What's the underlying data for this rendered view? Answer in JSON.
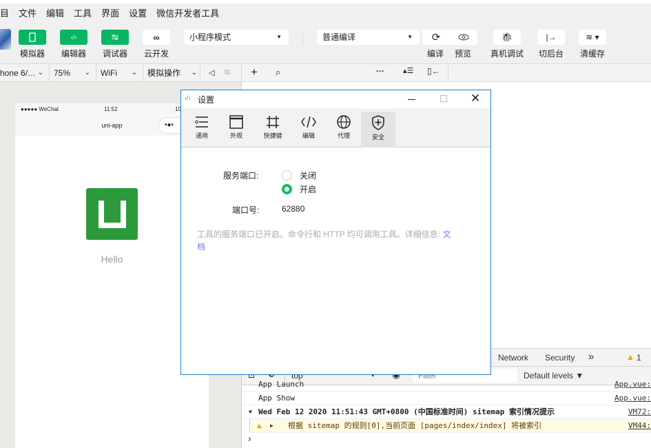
{
  "menu": [
    "目",
    "文件",
    "编辑",
    "工具",
    "界面",
    "设置",
    "微信开发者工具"
  ],
  "toolbar": {
    "simulator": "模拟器",
    "editor": "编辑器",
    "debugger": "调试器",
    "cloud": "云开发",
    "mode_select": "小程序模式",
    "compile_select": "普通编译",
    "compile": "编译",
    "preview": "预览",
    "remote_debug": "真机调试",
    "background": "切后台",
    "clear_cache": "清缓存"
  },
  "toolbar2": {
    "device": "hone 6/…",
    "zoom": "75%",
    "network": "WiFi",
    "simulate_ops": "模拟操作"
  },
  "phone": {
    "carrier": "●●●●● WeChat",
    "time": "11:52",
    "battery": "10",
    "nav_title": "uni-app",
    "capsule": "•●•",
    "hello": "Hello",
    "logo_color": "#2d9a3c"
  },
  "dialog": {
    "title": "设置",
    "tabs": [
      {
        "label": "通用",
        "icon": "sliders-icon"
      },
      {
        "label": "外观",
        "icon": "window-icon"
      },
      {
        "label": "快捷键",
        "icon": "command-icon"
      },
      {
        "label": "编辑",
        "icon": "code-icon"
      },
      {
        "label": "代理",
        "icon": "globe-icon"
      },
      {
        "label": "安全",
        "icon": "shield-plus-icon",
        "active": true
      }
    ],
    "service_port_label": "服务端口:",
    "options": [
      {
        "label": "关闭",
        "selected": false
      },
      {
        "label": "开启",
        "selected": true
      }
    ],
    "port_label": "端口号:",
    "port_value": "62880",
    "info_text": "工具的服务端口已开启。命令行和 HTTP 均可调用工具。详细信息:",
    "info_link": "文档",
    "accent": "#07c160"
  },
  "devtools": {
    "tabs": [
      "Network",
      "Security"
    ],
    "more": "»",
    "warn_count": "1",
    "context": "top",
    "filter_placeholder": "Filter",
    "levels": "Default levels ▼",
    "logs": [
      {
        "text": "App Launch",
        "src": "App.vue:"
      },
      {
        "text": "App Show",
        "src": "App.vue:"
      },
      {
        "text": "Wed Feb 12 2020 11:51:43 GMT+0800 (中国标准时间) sitemap 索引情况提示",
        "src": "VM72:"
      },
      {
        "text": "根据 sitemap 的规则[0],当前页面 [pages/index/index] 将被索引",
        "src": "VM44:"
      }
    ],
    "prompt": "›"
  }
}
